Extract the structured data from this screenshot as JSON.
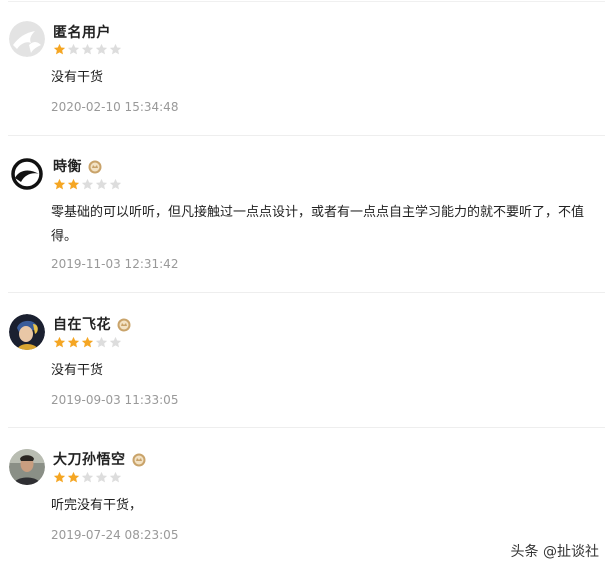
{
  "reviews": [
    {
      "name": "匿名用户",
      "has_badge": false,
      "rating": 1,
      "max_rating": 5,
      "comment": "没有干货",
      "date": "2020-02-10 15:34:48",
      "avatar": "anonymous-avatar"
    },
    {
      "name": "時衡",
      "has_badge": true,
      "rating": 2,
      "max_rating": 5,
      "comment": "零基础的可以听听，但凡接触过一点点设计，或者有一点点自主学习能力的就不要听了，不值得。",
      "date": "2019-11-03 12:31:42",
      "avatar": "wave-logo-avatar"
    },
    {
      "name": "自在飞花",
      "has_badge": true,
      "rating": 3,
      "max_rating": 5,
      "comment": "没有干货",
      "date": "2019-09-03 11:33:05",
      "avatar": "painting-girl-avatar"
    },
    {
      "name": "大刀孙悟空",
      "has_badge": true,
      "rating": 2,
      "max_rating": 5,
      "comment": "听完没有干货，",
      "date": "2019-07-24 08:23:05",
      "avatar": "man-photo-avatar"
    }
  ],
  "watermark": "头条 @扯谈社",
  "colors": {
    "star_filled": "#f5a623",
    "star_empty": "#dddddd",
    "date_text": "#999999",
    "badge": "#c9a36a"
  }
}
